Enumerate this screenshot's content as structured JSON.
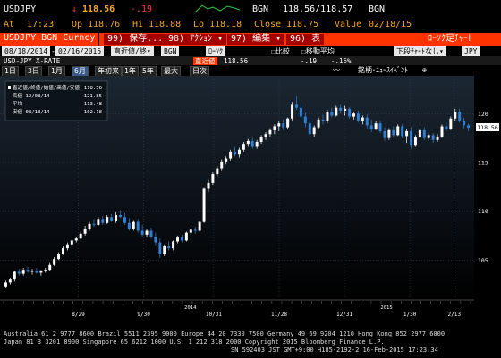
{
  "header": {
    "ticker": "USDJPY",
    "price_arrow": "↓",
    "price": "118.56",
    "change": "-.19",
    "bgn_label": "BGN",
    "bid_ask": "118.56/118.57",
    "bgn_label2": "BGN",
    "at_label": "At",
    "at_time": "17:23",
    "op_label": "Op",
    "op_value": "118.76",
    "hi_label": "Hi",
    "hi_value": "118.88",
    "lo_label": "Lo",
    "lo_value": "118.18",
    "close_label": "Close",
    "close_value": "118.75",
    "value_label": "Value",
    "value_date": "02/18/15"
  },
  "toolbar": {
    "security": "USDJPY BGN Curncy",
    "menu_save": "99) 保存...",
    "menu_actions": "98) ｱｸｼｮﾝ ▾",
    "menu_edit": "97) 編集 ▾",
    "menu_table": "96) 表",
    "menu_candle": "ﾛｰｿｸ足ﾁｬｰﾄ"
  },
  "controls": {
    "start_date": "08/18/2014",
    "end_date": "02/16/2015",
    "price_type": "直近値/終▾",
    "source": "BGN",
    "chart_type": "ﾛｰｿｸ",
    "compare": "比較",
    "moving_avg": "移動平均",
    "lower_chart": "下段ﾁｬｰﾄなし▾",
    "currency": "JPY"
  },
  "controls2": {
    "security_label": "USD-JPY X-RATE",
    "last_label": "直近値",
    "last_value": "118.56",
    "change": "-.19",
    "pct_change": "-.16%"
  },
  "periods": [
    "1日",
    "3日",
    "1月",
    "6月",
    "年初来",
    "1年",
    "5年",
    "最大"
  ],
  "selected_period": "6月",
  "period_extra": "日次",
  "tool_labels": {
    "line": "〰",
    "draw": "銘柄･ﾆｭｰｽｲﾍﾞﾝﾄ",
    "zoom": "⊕"
  },
  "legend": {
    "title": "直近値/終値/始値/高値/安値",
    "rows": [
      {
        "label": "直近値/終値/始値/高値/安値",
        "value": "118.56"
      },
      {
        "label": "高値 12/08/14",
        "value": "121.85"
      },
      {
        "label": "平均",
        "value": "113.48"
      },
      {
        "label": "安値 08/18/14",
        "value": "102.18"
      }
    ]
  },
  "chart_data": {
    "type": "candlestick",
    "y_ticks": [
      105,
      110,
      115,
      120
    ],
    "ylim": [
      101,
      123.5
    ],
    "last_value_label": "118.56",
    "x_ticks": [
      "8/29",
      "9/30",
      "10/31",
      "11/28",
      "12/31",
      "1/30",
      "2/13"
    ],
    "x_year_labels": [
      {
        "label": "2014",
        "at": "10/31"
      },
      {
        "label": "2015",
        "at": "1/30"
      }
    ],
    "x_minor_ticks": [
      "9/12",
      "10/17",
      "11/14",
      "12/15",
      "1/16"
    ],
    "grid": true,
    "colors": {
      "up": "#ffffff",
      "down": "#2f7fd6",
      "grid": "#3a4a5a",
      "bg_top": "#0a0f14",
      "bg_bottom": "#000000"
    },
    "candles": [
      {
        "o": 102.3,
        "h": 102.9,
        "l": 102.1,
        "c": 102.7
      },
      {
        "o": 102.7,
        "h": 103.2,
        "l": 102.5,
        "c": 103.0
      },
      {
        "o": 103.0,
        "h": 103.9,
        "l": 102.8,
        "c": 103.8
      },
      {
        "o": 103.8,
        "h": 104.1,
        "l": 103.4,
        "c": 103.6
      },
      {
        "o": 103.6,
        "h": 104.2,
        "l": 103.4,
        "c": 104.0
      },
      {
        "o": 104.0,
        "h": 104.3,
        "l": 103.7,
        "c": 103.8
      },
      {
        "o": 103.8,
        "h": 104.1,
        "l": 103.5,
        "c": 103.9
      },
      {
        "o": 103.9,
        "h": 104.2,
        "l": 103.6,
        "c": 103.7
      },
      {
        "o": 103.7,
        "h": 104.0,
        "l": 103.4,
        "c": 103.9
      },
      {
        "o": 103.9,
        "h": 104.2,
        "l": 103.7,
        "c": 104.0
      },
      {
        "o": 104.0,
        "h": 104.7,
        "l": 103.9,
        "c": 104.5
      },
      {
        "o": 104.5,
        "h": 105.3,
        "l": 104.4,
        "c": 105.1
      },
      {
        "o": 105.1,
        "h": 105.8,
        "l": 105.0,
        "c": 105.6
      },
      {
        "o": 105.6,
        "h": 106.4,
        "l": 105.5,
        "c": 106.2
      },
      {
        "o": 106.2,
        "h": 106.8,
        "l": 106.0,
        "c": 106.6
      },
      {
        "o": 106.6,
        "h": 107.1,
        "l": 106.3,
        "c": 107.0
      },
      {
        "o": 107.0,
        "h": 107.4,
        "l": 106.8,
        "c": 107.2
      },
      {
        "o": 107.2,
        "h": 107.9,
        "l": 107.1,
        "c": 107.7
      },
      {
        "o": 107.7,
        "h": 108.5,
        "l": 107.5,
        "c": 108.2
      },
      {
        "o": 108.2,
        "h": 108.9,
        "l": 108.0,
        "c": 108.7
      },
      {
        "o": 108.7,
        "h": 109.2,
        "l": 108.4,
        "c": 108.6
      },
      {
        "o": 108.6,
        "h": 109.4,
        "l": 108.5,
        "c": 109.2
      },
      {
        "o": 109.2,
        "h": 109.5,
        "l": 108.6,
        "c": 108.8
      },
      {
        "o": 108.8,
        "h": 109.6,
        "l": 108.7,
        "c": 109.4
      },
      {
        "o": 109.4,
        "h": 109.7,
        "l": 108.9,
        "c": 109.0
      },
      {
        "o": 109.0,
        "h": 109.9,
        "l": 108.8,
        "c": 109.6
      },
      {
        "o": 109.6,
        "h": 110.1,
        "l": 109.3,
        "c": 109.4
      },
      {
        "o": 109.4,
        "h": 109.8,
        "l": 108.6,
        "c": 108.8
      },
      {
        "o": 108.8,
        "h": 109.3,
        "l": 108.0,
        "c": 108.2
      },
      {
        "o": 108.2,
        "h": 109.1,
        "l": 108.0,
        "c": 108.9
      },
      {
        "o": 108.9,
        "h": 109.2,
        "l": 107.8,
        "c": 108.0
      },
      {
        "o": 108.0,
        "h": 108.6,
        "l": 107.4,
        "c": 107.6
      },
      {
        "o": 107.6,
        "h": 108.2,
        "l": 107.3,
        "c": 108.0
      },
      {
        "o": 108.0,
        "h": 108.3,
        "l": 107.2,
        "c": 107.4
      },
      {
        "o": 107.4,
        "h": 107.8,
        "l": 106.5,
        "c": 106.8
      },
      {
        "o": 106.8,
        "h": 107.2,
        "l": 105.2,
        "c": 105.6
      },
      {
        "o": 105.6,
        "h": 106.6,
        "l": 105.4,
        "c": 106.4
      },
      {
        "o": 106.4,
        "h": 106.9,
        "l": 106.0,
        "c": 106.2
      },
      {
        "o": 106.2,
        "h": 107.0,
        "l": 106.0,
        "c": 106.9
      },
      {
        "o": 106.9,
        "h": 107.5,
        "l": 106.7,
        "c": 107.3
      },
      {
        "o": 107.3,
        "h": 107.6,
        "l": 106.8,
        "c": 107.0
      },
      {
        "o": 107.0,
        "h": 107.9,
        "l": 106.9,
        "c": 107.8
      },
      {
        "o": 107.8,
        "h": 108.3,
        "l": 107.5,
        "c": 108.1
      },
      {
        "o": 108.1,
        "h": 108.4,
        "l": 107.7,
        "c": 108.0
      },
      {
        "o": 108.0,
        "h": 109.0,
        "l": 107.9,
        "c": 108.9
      },
      {
        "o": 108.9,
        "h": 112.4,
        "l": 108.8,
        "c": 112.3
      },
      {
        "o": 112.3,
        "h": 113.2,
        "l": 112.0,
        "c": 112.9
      },
      {
        "o": 112.9,
        "h": 114.0,
        "l": 112.7,
        "c": 113.8
      },
      {
        "o": 113.8,
        "h": 114.6,
        "l": 113.5,
        "c": 114.4
      },
      {
        "o": 114.4,
        "h": 115.3,
        "l": 114.2,
        "c": 115.1
      },
      {
        "o": 115.1,
        "h": 115.6,
        "l": 114.8,
        "c": 115.4
      },
      {
        "o": 115.4,
        "h": 116.3,
        "l": 115.2,
        "c": 116.1
      },
      {
        "o": 116.1,
        "h": 116.6,
        "l": 115.6,
        "c": 115.8
      },
      {
        "o": 115.8,
        "h": 116.5,
        "l": 115.5,
        "c": 116.3
      },
      {
        "o": 116.3,
        "h": 117.1,
        "l": 116.1,
        "c": 116.9
      },
      {
        "o": 116.9,
        "h": 117.4,
        "l": 116.6,
        "c": 117.2
      },
      {
        "o": 117.2,
        "h": 117.5,
        "l": 116.4,
        "c": 116.6
      },
      {
        "o": 116.6,
        "h": 117.3,
        "l": 116.4,
        "c": 117.1
      },
      {
        "o": 117.1,
        "h": 117.8,
        "l": 116.9,
        "c": 117.6
      },
      {
        "o": 117.6,
        "h": 118.1,
        "l": 117.3,
        "c": 117.9
      },
      {
        "o": 117.9,
        "h": 118.5,
        "l": 117.6,
        "c": 118.3
      },
      {
        "o": 118.3,
        "h": 118.9,
        "l": 117.9,
        "c": 118.7
      },
      {
        "o": 118.7,
        "h": 119.2,
        "l": 118.2,
        "c": 119.0
      },
      {
        "o": 119.0,
        "h": 119.4,
        "l": 118.3,
        "c": 118.6
      },
      {
        "o": 118.6,
        "h": 119.6,
        "l": 118.4,
        "c": 119.5
      },
      {
        "o": 119.5,
        "h": 121.2,
        "l": 119.3,
        "c": 120.9
      },
      {
        "o": 120.9,
        "h": 121.8,
        "l": 120.4,
        "c": 120.6
      },
      {
        "o": 120.6,
        "h": 121.0,
        "l": 119.4,
        "c": 119.7
      },
      {
        "o": 119.7,
        "h": 120.1,
        "l": 118.6,
        "c": 119.0
      },
      {
        "o": 119.0,
        "h": 119.3,
        "l": 117.7,
        "c": 117.9
      },
      {
        "o": 117.9,
        "h": 118.8,
        "l": 117.6,
        "c": 118.6
      },
      {
        "o": 118.6,
        "h": 119.6,
        "l": 118.4,
        "c": 119.4
      },
      {
        "o": 119.4,
        "h": 119.9,
        "l": 118.9,
        "c": 119.2
      },
      {
        "o": 119.2,
        "h": 120.4,
        "l": 119.0,
        "c": 120.2
      },
      {
        "o": 120.2,
        "h": 120.6,
        "l": 119.6,
        "c": 119.8
      },
      {
        "o": 119.8,
        "h": 120.8,
        "l": 119.7,
        "c": 120.6
      },
      {
        "o": 120.6,
        "h": 120.9,
        "l": 120.0,
        "c": 120.3
      },
      {
        "o": 120.3,
        "h": 120.8,
        "l": 119.8,
        "c": 120.5
      },
      {
        "o": 120.5,
        "h": 120.7,
        "l": 119.5,
        "c": 119.7
      },
      {
        "o": 119.7,
        "h": 120.2,
        "l": 119.4,
        "c": 120.0
      },
      {
        "o": 120.0,
        "h": 120.3,
        "l": 119.1,
        "c": 119.3
      },
      {
        "o": 119.3,
        "h": 119.8,
        "l": 118.9,
        "c": 119.6
      },
      {
        "o": 119.6,
        "h": 119.9,
        "l": 118.5,
        "c": 118.8
      },
      {
        "o": 118.8,
        "h": 119.4,
        "l": 118.1,
        "c": 118.4
      },
      {
        "o": 118.4,
        "h": 119.2,
        "l": 118.3,
        "c": 119.0
      },
      {
        "o": 119.0,
        "h": 119.3,
        "l": 118.0,
        "c": 118.2
      },
      {
        "o": 118.2,
        "h": 118.6,
        "l": 117.2,
        "c": 117.5
      },
      {
        "o": 117.5,
        "h": 118.5,
        "l": 117.3,
        "c": 118.3
      },
      {
        "o": 118.3,
        "h": 118.7,
        "l": 117.6,
        "c": 117.8
      },
      {
        "o": 117.8,
        "h": 118.9,
        "l": 117.7,
        "c": 118.7
      },
      {
        "o": 118.7,
        "h": 118.9,
        "l": 117.5,
        "c": 117.7
      },
      {
        "o": 117.7,
        "h": 118.4,
        "l": 117.0,
        "c": 118.2
      },
      {
        "o": 118.2,
        "h": 118.6,
        "l": 116.4,
        "c": 116.8
      },
      {
        "o": 116.8,
        "h": 117.8,
        "l": 116.6,
        "c": 117.6
      },
      {
        "o": 117.6,
        "h": 118.5,
        "l": 117.4,
        "c": 118.3
      },
      {
        "o": 118.3,
        "h": 118.6,
        "l": 117.3,
        "c": 117.5
      },
      {
        "o": 117.5,
        "h": 118.1,
        "l": 117.2,
        "c": 117.8
      },
      {
        "o": 117.8,
        "h": 118.0,
        "l": 117.0,
        "c": 117.3
      },
      {
        "o": 117.3,
        "h": 117.9,
        "l": 117.1,
        "c": 117.6
      },
      {
        "o": 117.6,
        "h": 118.9,
        "l": 117.5,
        "c": 118.7
      },
      {
        "o": 118.7,
        "h": 119.1,
        "l": 118.2,
        "c": 118.4
      },
      {
        "o": 118.4,
        "h": 119.7,
        "l": 118.3,
        "c": 119.5
      },
      {
        "o": 119.5,
        "h": 120.5,
        "l": 119.2,
        "c": 120.2
      },
      {
        "o": 120.2,
        "h": 120.5,
        "l": 119.1,
        "c": 119.3
      },
      {
        "o": 119.3,
        "h": 119.6,
        "l": 118.5,
        "c": 118.8
      },
      {
        "o": 118.8,
        "h": 119.0,
        "l": 118.2,
        "c": 118.56
      }
    ]
  },
  "footer": {
    "line1": "Australia 61 2 9777 8600 Brazil 5511 2395 9000 Europe 44 20 7330 7500 Germany 49 69 9204 1210 Hong Kong 852 2977 6000",
    "line2": "Japan 81 3 3201 8900          Singapore 65 6212 1000          U.S. 1 212 318 2000          Copyright 2015 Bloomberg Finance L.P.",
    "line3": "SN 592403 JST  GMT+9:00 H185-2192-2 16-Feb-2015 17:23:34"
  }
}
